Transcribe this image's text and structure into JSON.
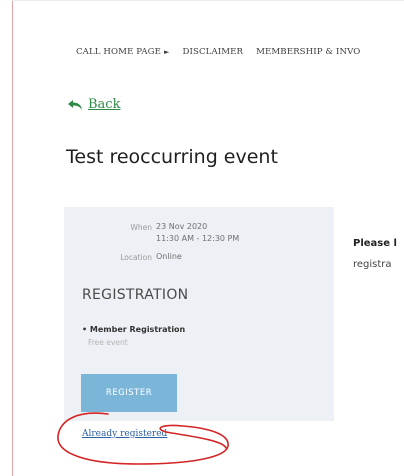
{
  "nav": {
    "items": [
      {
        "label": "CALL HOME PAGE",
        "arrow": "►"
      },
      {
        "label": "DISCLAIMER"
      },
      {
        "label": "MEMBERSHIP & INVO"
      }
    ]
  },
  "back": {
    "label": "Back"
  },
  "event": {
    "title": "Test reoccurring event"
  },
  "details": {
    "when_label": "When",
    "date": "23 Nov 2020",
    "time": "11:30 AM - 12:30 PM",
    "location_label": "Location",
    "location": "Online"
  },
  "registration": {
    "heading": "REGISTRATION",
    "item": "• Member Registration",
    "item_sub": "Free event",
    "register_label": "REGISTER",
    "already_registered": "Already registered"
  },
  "side": {
    "bold": "Please l",
    "text": "registra"
  },
  "colors": {
    "link_green": "#2f8a45",
    "button_blue": "#7bb6d9",
    "panel_bg": "#edf1f5",
    "annotation_red": "#d32525"
  }
}
